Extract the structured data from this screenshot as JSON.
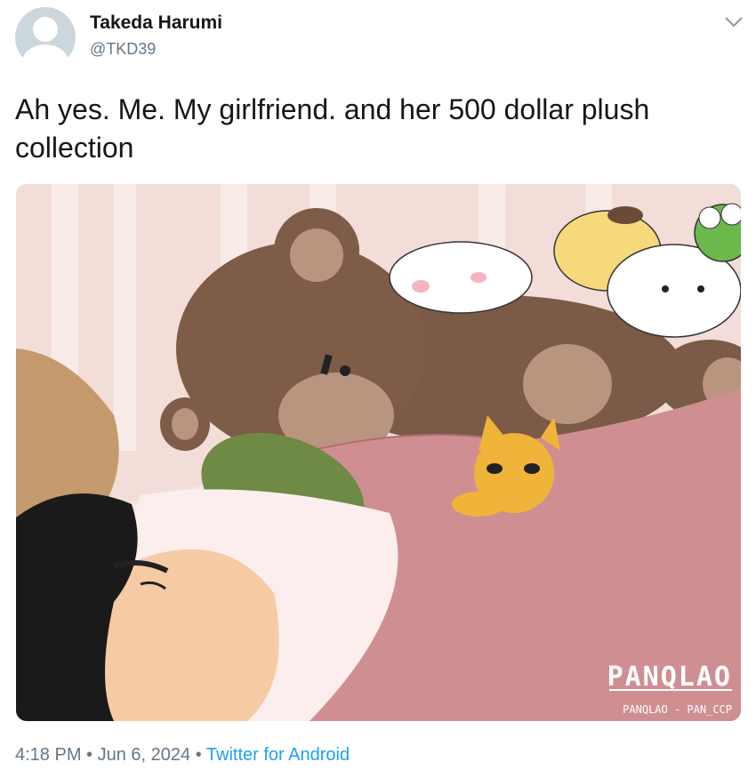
{
  "author": {
    "name": "Takeda Harumi",
    "handle": "@TKD39",
    "avatar_icon": "default-profile-icon"
  },
  "menu_icon": "chevron-down-icon",
  "tweet": {
    "text": "Ah yes. Me. My girlfriend. and her 500 dollar plush collection"
  },
  "media": {
    "description_icon": "illustration",
    "watermark": "PANQLAO",
    "watermark_sub": "PANQLAO - PAN_CCP"
  },
  "meta": {
    "time": "4:18 PM",
    "sep1": " • ",
    "date": "Jun 6, 2024",
    "sep2": " • ",
    "source": "Twitter for Android"
  },
  "colors": {
    "link": "#1da1f2",
    "secondary_text": "#657786"
  }
}
